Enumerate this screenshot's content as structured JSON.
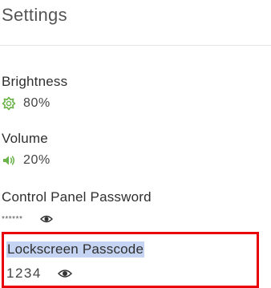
{
  "header": {
    "title": "Settings"
  },
  "brightness": {
    "label": "Brightness",
    "value": "80%",
    "icon": "brightness-icon"
  },
  "volume": {
    "label": "Volume",
    "value": "20%",
    "icon": "speaker-icon"
  },
  "control_panel_password": {
    "label": "Control Panel Password",
    "value": "******",
    "icon": "eye-icon"
  },
  "lockscreen_passcode": {
    "label": "Lockscreen Passcode",
    "value": "1234",
    "icon": "eye-icon",
    "highlight_color": "#c5d4f2",
    "outline_color": "#e8000b"
  }
}
